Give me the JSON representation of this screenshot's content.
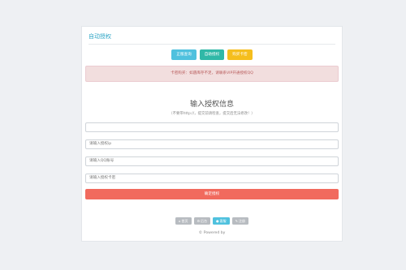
{
  "header": {
    "title": "自动授权"
  },
  "top_buttons": [
    {
      "label": "正版查询"
    },
    {
      "label": "自助授权"
    },
    {
      "label": "购买卡密"
    }
  ],
  "notice": {
    "text": "卡密购买：如遇库存不足，请联系VIP开通授权QQ"
  },
  "form": {
    "title": "输入授权信息",
    "subtitle": "（不要带http://，提交前请检查，提交后无法修改！）",
    "fields": [
      {
        "placeholder": "",
        "value": ""
      },
      {
        "placeholder": "请输入授权ip",
        "value": ""
      },
      {
        "placeholder": "请输入QQ账号",
        "value": ""
      },
      {
        "placeholder": "请输入授权卡密",
        "value": ""
      }
    ],
    "submit_label": "确定授权"
  },
  "bottom_buttons": [
    {
      "icon": "home-icon",
      "label": "首页"
    },
    {
      "icon": "gear-icon",
      "label": "后台"
    },
    {
      "icon": "user-icon",
      "label": "客服"
    },
    {
      "icon": "pencil-icon",
      "label": "注册"
    }
  ],
  "footer": {
    "text": "© Powered by"
  },
  "colors": {
    "accent": "#2fa6c6",
    "cyan_button": "#4fc1de",
    "teal_button": "#30b8a7",
    "yellow_button": "#f5be1d",
    "submit": "#f16a5e",
    "notice_bg": "#f2dede"
  }
}
